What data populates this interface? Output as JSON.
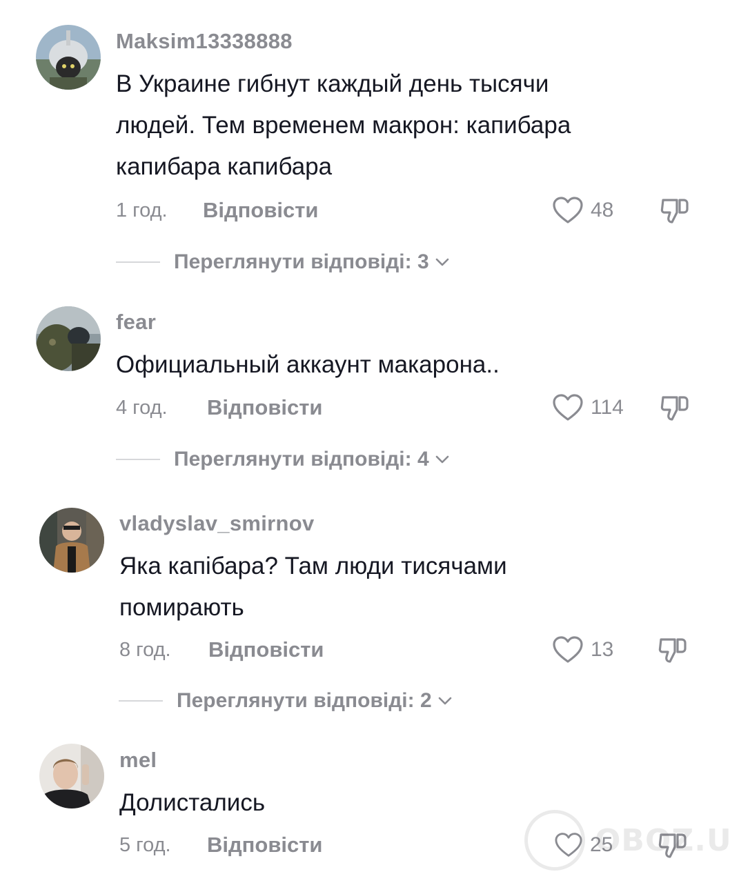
{
  "comments": [
    {
      "username": "Maksim13338888",
      "avatar_icon": "pilot-cat-avatar",
      "text_lines": [
        "В Украине гибнут каждый день тысячи",
        "людей. Тем временем макрон: капибара",
        "капибара капибара"
      ],
      "time": "1 год.",
      "reply_label": "Відповісти",
      "likes": "48",
      "view_replies": "Переглянути відповіді: 3"
    },
    {
      "username": "fear",
      "avatar_icon": "soldier-avatar",
      "text_lines": [
        "Официальный аккаунт макарона.."
      ],
      "time": "4 год.",
      "reply_label": "Відповісти",
      "likes": "114",
      "view_replies": "Переглянути відповіді: 4"
    },
    {
      "username": "vladyslav_smirnov",
      "avatar_icon": "man-in-coat-avatar",
      "text_lines": [
        "Яка капібара? Там люди тисячами",
        "помирають"
      ],
      "time": "8 год.",
      "reply_label": "Відповісти",
      "likes": "13",
      "view_replies": "Переглянути відповіді: 2"
    },
    {
      "username": "mel",
      "avatar_icon": "selfie-avatar",
      "text_lines": [
        "Долистались"
      ],
      "time": "5 год.",
      "reply_label": "Відповісти",
      "likes": "25",
      "view_replies": ""
    }
  ],
  "watermark": "OBOZ.UA",
  "colors": {
    "text": "#161823",
    "secondary": "#8a8b91",
    "divider": "#d6d7da",
    "background": "#ffffff"
  },
  "icons": [
    "heart-outline-icon",
    "thumbs-down-icon",
    "chevron-down-icon"
  ]
}
